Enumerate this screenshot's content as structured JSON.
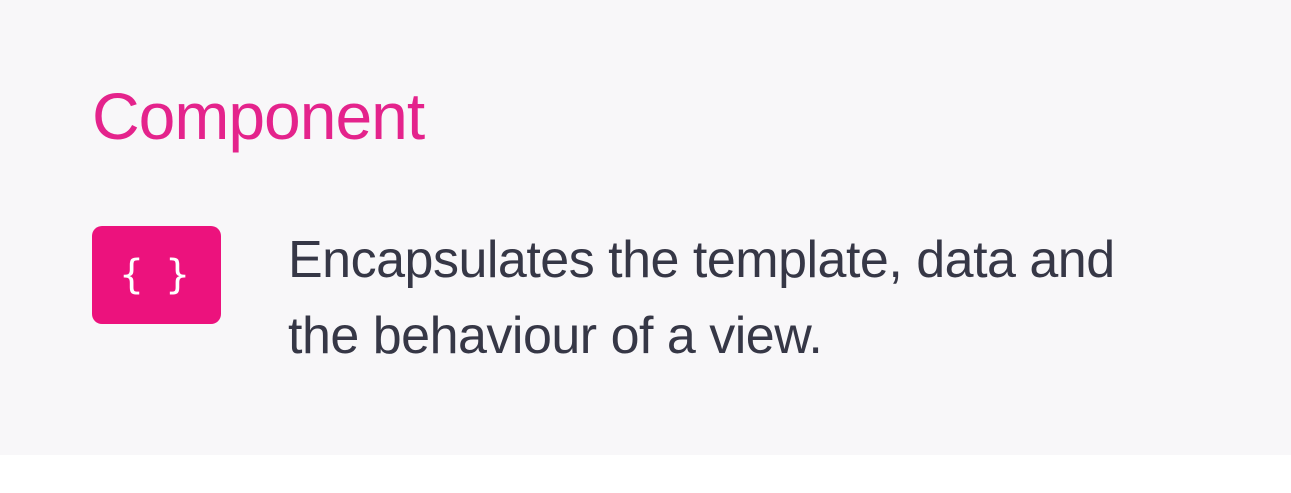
{
  "heading": {
    "text": "Component",
    "color": "#e4238c"
  },
  "badge": {
    "icon": "curly-braces-icon",
    "glyph": "{ }",
    "background": "#ec127d",
    "foreground": "#ffffff"
  },
  "description": {
    "lines": [
      "Encapsulates the template, data and",
      "the behaviour of a view."
    ],
    "color": "#363746"
  },
  "colors": {
    "slide_background": "#f8f7f9"
  }
}
